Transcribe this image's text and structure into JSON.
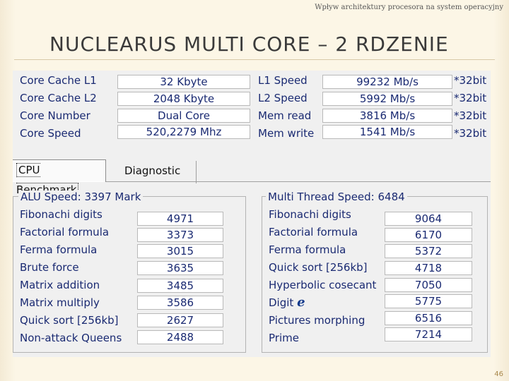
{
  "slide": {
    "caption": "Wpływ architektury procesora na system operacyjny",
    "title": "NUCLEARUS MULTI CORE – 2 RDZENIE",
    "page_number": "46"
  },
  "cpu_info": {
    "left": [
      {
        "label": "Core Cache L1",
        "value": "32 Kbyte"
      },
      {
        "label": "Core Cache L2",
        "value": "2048 Kbyte"
      },
      {
        "label": "Core Number",
        "value": "Dual Core"
      },
      {
        "label": "Core Speed",
        "value": "520,2279 Mhz"
      }
    ],
    "right": [
      {
        "label": "L1 Speed",
        "value": "99232 Mb/s",
        "bits": "*32bit"
      },
      {
        "label": "L2 Speed",
        "value": "5992 Mb/s",
        "bits": "*32bit"
      },
      {
        "label": "Mem read",
        "value": "3816 Mb/s",
        "bits": "*32bit"
      },
      {
        "label": "Mem write",
        "value": "1541 Mb/s",
        "bits": "*32bit"
      }
    ]
  },
  "tabs": [
    {
      "label": "CPU Benchmark",
      "active": true
    },
    {
      "label": "Diagnostic",
      "active": false
    }
  ],
  "alu_group": {
    "title": "ALU Speed: 3397 Mark",
    "rows": [
      {
        "label": "Fibonachi digits",
        "value": "4971"
      },
      {
        "label": "Factorial formula",
        "value": "3373"
      },
      {
        "label": "Ferma formula",
        "value": "3015"
      },
      {
        "label": "Brute force",
        "value": "3635"
      },
      {
        "label": "Matrix addition",
        "value": "3485"
      },
      {
        "label": "Matrix multiply",
        "value": "3586"
      },
      {
        "label": "Quick sort [256kb]",
        "value": "2627"
      },
      {
        "label": "Non-attack Queens",
        "value": "2488"
      }
    ]
  },
  "mt_group": {
    "title": "Multi Thread Speed: 6484",
    "rows": [
      {
        "label": "Fibonachi digits",
        "value": "9064"
      },
      {
        "label": "Factorial formula",
        "value": "6170"
      },
      {
        "label": "Ferma formula",
        "value": "5372"
      },
      {
        "label": "Quick sort [256kb]",
        "value": "4718"
      },
      {
        "label": "Hyperbolic cosecant",
        "value": "7050"
      },
      {
        "label": "Digit",
        "value": "5775",
        "icon": "e-icon"
      },
      {
        "label": "Pictures morphing",
        "value": "6516"
      },
      {
        "label": "Prime",
        "value": "7214"
      }
    ]
  },
  "colors": {
    "label_text": "#1a2a72",
    "slide_background": "#fcf6e6"
  }
}
